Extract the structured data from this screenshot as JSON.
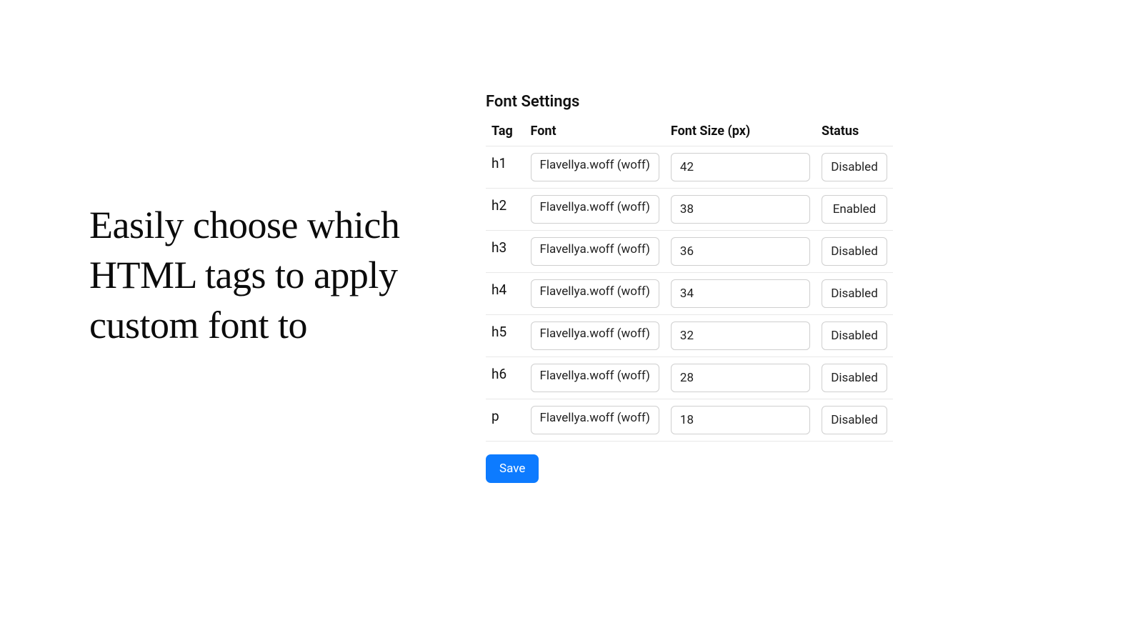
{
  "left": {
    "headline": "Easily choose which HTML tags to apply custom font to"
  },
  "panel": {
    "title": "Font Settings",
    "columns": {
      "tag": "Tag",
      "font": "Font",
      "size": "Font Size (px)",
      "status": "Status"
    },
    "rows": [
      {
        "tag": "h1",
        "font": "Flavellya.woff (woff)",
        "size": "42",
        "status": "Disabled"
      },
      {
        "tag": "h2",
        "font": "Flavellya.woff (woff)",
        "size": "38",
        "status": "Enabled"
      },
      {
        "tag": "h3",
        "font": "Flavellya.woff (woff)",
        "size": "36",
        "status": "Disabled"
      },
      {
        "tag": "h4",
        "font": "Flavellya.woff (woff)",
        "size": "34",
        "status": "Disabled"
      },
      {
        "tag": "h5",
        "font": "Flavellya.woff (woff)",
        "size": "32",
        "status": "Disabled"
      },
      {
        "tag": "h6",
        "font": "Flavellya.woff (woff)",
        "size": "28",
        "status": "Disabled"
      },
      {
        "tag": "p",
        "font": "Flavellya.woff (woff)",
        "size": "18",
        "status": "Disabled"
      }
    ],
    "save_label": "Save"
  }
}
